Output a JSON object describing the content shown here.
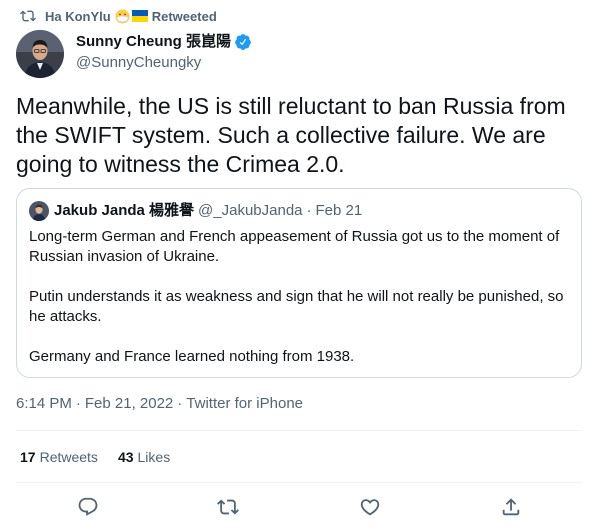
{
  "retweet_context": {
    "name": "Ha KonYlu",
    "label": "Retweeted",
    "emoji_icons": [
      "face-with-medical-mask-icon",
      "ukraine-flag-icon"
    ]
  },
  "author": {
    "name": "Sunny Cheung 張崑陽",
    "handle": "@SunnyCheungky",
    "verified": true
  },
  "tweet": {
    "text": "Meanwhile, the US is still reluctant to ban Russia from the SWIFT system. Such a collective failure. We are going to witness the Crimea 2.0."
  },
  "quoted_tweet": {
    "author_name": "Jakub Janda 楊雅譽",
    "handle": "@_JakubJanda",
    "separator": "·",
    "date": "Feb 21",
    "paragraphs": [
      "Long-term German and French appeasement of Russia got us to the moment of Russian invasion of Ukraine.",
      "Putin understands it as weakness and sign that he will not really be punished, so he attacks.",
      "Germany and France learned nothing from 1938."
    ]
  },
  "meta": {
    "time": "6:14 PM",
    "sep1": "·",
    "date": "Feb 21, 2022",
    "sep2": "·",
    "source": "Twitter for iPhone"
  },
  "stats": {
    "retweets_count": "17",
    "retweets_label": "Retweets",
    "likes_count": "43",
    "likes_label": "Likes"
  },
  "actions": [
    "reply-icon",
    "retweet-icon",
    "like-icon",
    "share-icon"
  ],
  "colors": {
    "text": "#0f1419",
    "secondary": "#536471",
    "border": "#cfd9de",
    "verified": "#1d9bf0"
  }
}
